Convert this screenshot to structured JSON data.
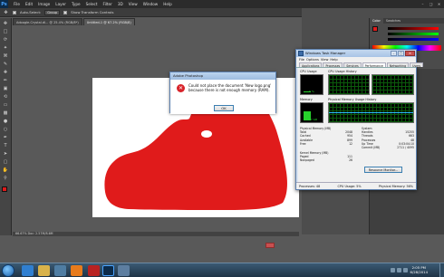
{
  "photoshop": {
    "logo": "Ps",
    "menu": [
      "File",
      "Edit",
      "Image",
      "Layer",
      "Type",
      "Select",
      "Filter",
      "3D",
      "View",
      "Window",
      "Help"
    ],
    "options": {
      "auto_select": "Auto-Select:",
      "group": "Group",
      "show_transform": "Show Transform Controls",
      "workspace": "Essentials"
    },
    "tabs": [
      "Adoogle-Crystal.dl... @ 25.4% (RGB/8*)",
      "Untitled-1 @ 67.2% (RGB/8)"
    ],
    "status": "66.67%    Doc: 2.57M/8.6M",
    "colors": {
      "foreground": "#e01b1b",
      "background": "#ffffff",
      "canvas": "#ffffff",
      "shoe": "#e01b1b"
    },
    "color_panel_tabs": [
      "Color",
      "Swatches"
    ]
  },
  "alert": {
    "title": "Adobe Photoshop",
    "message": "Could not place the document 'New logo.png' because there is not enough memory (RAM).",
    "ok_label": "OK",
    "icon": "error-icon"
  },
  "task_manager": {
    "title": "Windows Task Manager",
    "menu": [
      "File",
      "Options",
      "View",
      "Help"
    ],
    "tabs": [
      "Applications",
      "Processes",
      "Services",
      "Performance",
      "Networking",
      "Users"
    ],
    "active_tab": "Performance",
    "labels": {
      "cpu_usage": "CPU Usage",
      "cpu_history": "CPU Usage History",
      "memory": "Memory",
      "mem_history": "Physical Memory Usage History"
    },
    "cpu_percent_text": "5 %",
    "cpu_level": 0.05,
    "memory_text": "1.17 GB",
    "memory_level": 0.55,
    "physical_memory": {
      "header": "Physical Memory (MB)",
      "rows": [
        [
          "Total",
          "2048"
        ],
        [
          "Cached",
          "954"
        ],
        [
          "Available",
          "899"
        ],
        [
          "Free",
          "12"
        ]
      ]
    },
    "kernel_memory": {
      "header": "Kernel Memory (MB)",
      "rows": [
        [
          "Paged",
          "111"
        ],
        [
          "Nonpaged",
          "26"
        ]
      ]
    },
    "system": {
      "header": "System",
      "rows": [
        [
          "Handles",
          "15255"
        ],
        [
          "Threads",
          "663"
        ],
        [
          "Processes",
          "48"
        ],
        [
          "Up Time",
          "0:03:04:10"
        ],
        [
          "Commit (MB)",
          "2711 / 4095"
        ]
      ]
    },
    "resource_monitor_label": "Resource Monitor...",
    "status": {
      "processes": "Processes: 48",
      "cpu": "CPU Usage: 5%",
      "memory": "Physical Memory: 56%"
    }
  },
  "taskbar": {
    "time": "2:05 PM",
    "date": "6/28/2014"
  }
}
